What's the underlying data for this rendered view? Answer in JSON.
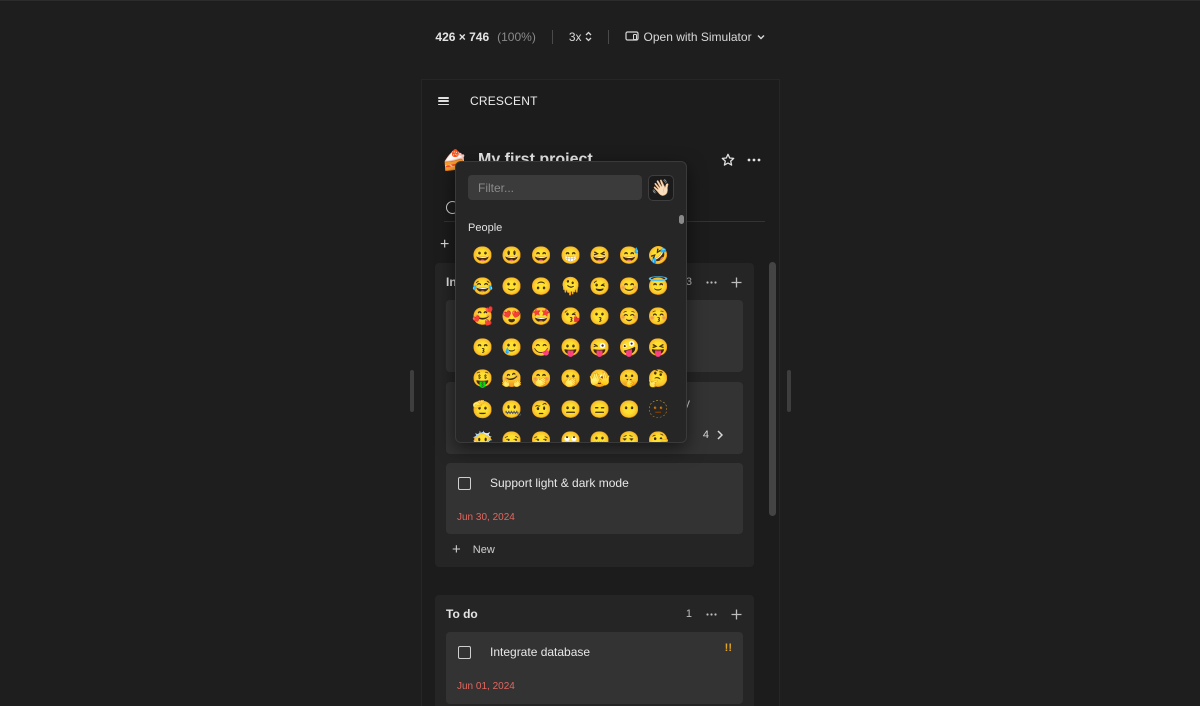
{
  "toolbar": {
    "size": "426 × 746",
    "zoom": "(100%)",
    "scale": "3x",
    "open_with": "Open with Simulator"
  },
  "app": {
    "title": "CRESCENT"
  },
  "project": {
    "emoji": "🍰",
    "title": "My first project"
  },
  "columns": [
    {
      "title": "In progress",
      "title_visible": "In",
      "count": "3",
      "cards": [
        {
          "title": "",
          "date": ""
        },
        {
          "title": "",
          "tail": "y",
          "subtask_count": "4"
        },
        {
          "title": "Support light & dark mode",
          "date": "Jun 30, 2024"
        }
      ],
      "new_label": "New"
    },
    {
      "title": "To do",
      "count": "1",
      "cards": [
        {
          "title": "Integrate database",
          "date": "Jun 01, 2024",
          "priority": "!!"
        }
      ]
    }
  ],
  "emoji_picker": {
    "filter_placeholder": "Filter...",
    "skin_tone": "👋🏻",
    "category": "People",
    "emojis": [
      "😀",
      "😃",
      "😄",
      "😁",
      "😆",
      "😅",
      "🤣",
      "😂",
      "🙂",
      "🙃",
      "🫠",
      "😉",
      "😊",
      "😇",
      "🥰",
      "😍",
      "🤩",
      "😘",
      "😗",
      "☺️",
      "😚",
      "😙",
      "🥲",
      "😋",
      "😛",
      "😜",
      "🤪",
      "😝",
      "🤑",
      "🤗",
      "🤭",
      "🫢",
      "🫣",
      "🤫",
      "🤔",
      "🫡",
      "🤐",
      "🤨",
      "😐",
      "😑",
      "😶",
      "🫥",
      "😶‍🌫️",
      "😏",
      "😒",
      "🙄",
      "😬",
      "😮‍💨",
      "🤥"
    ]
  },
  "colors": {
    "background": "#1e1e1e",
    "column_bg": "#252525",
    "card_bg": "#333333",
    "date_red": "#e2675f",
    "priority_yellow": "#e0a425"
  }
}
